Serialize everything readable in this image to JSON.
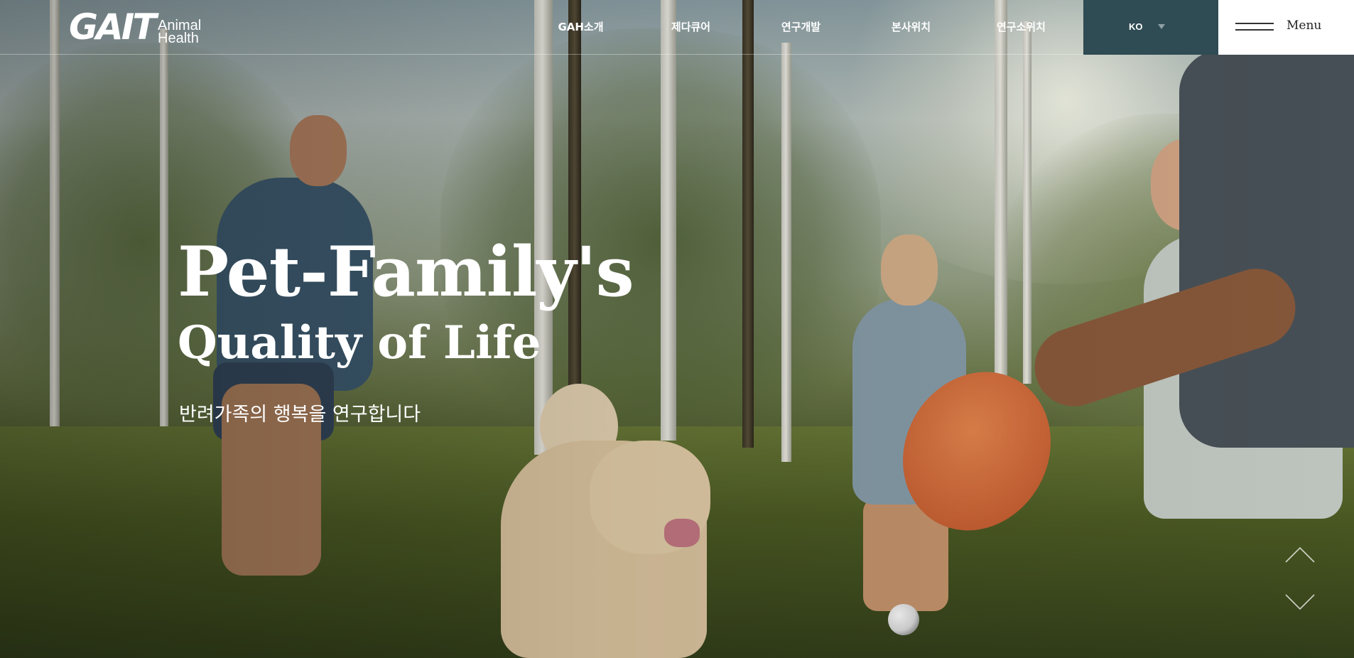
{
  "brand": {
    "logo_mark": "GAIT",
    "logo_line1": "Animal",
    "logo_line2": "Health"
  },
  "nav": {
    "items": [
      {
        "label": "GAH소개"
      },
      {
        "label": "제다큐어"
      },
      {
        "label": "연구개발"
      },
      {
        "label": "본사위치"
      },
      {
        "label": "연구소위치"
      }
    ]
  },
  "language": {
    "selected": "KO"
  },
  "menu": {
    "label": "Menu",
    "icon": "hamburger-icon"
  },
  "hero": {
    "title": "Pet-Family's",
    "subtitle": "Quality of Life",
    "tagline": "반려가족의 행복을 연구합니다",
    "background": "family-playing-with-dog-photo"
  },
  "slider": {
    "prev_icon": "chevron-up-icon",
    "next_icon": "chevron-down-icon"
  },
  "colors": {
    "lang_bg": "#2f4b53",
    "menu_bg": "#ffffff",
    "text_on_hero": "#ffffff"
  }
}
